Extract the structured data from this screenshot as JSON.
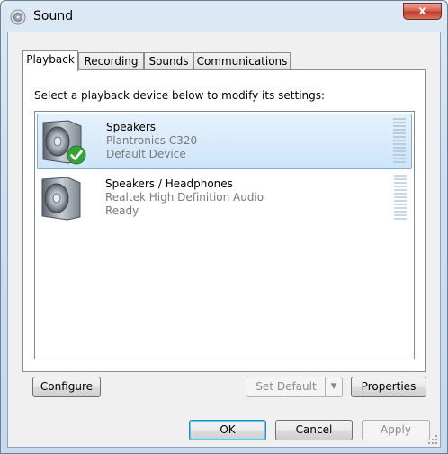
{
  "window": {
    "title": "Sound",
    "close_label": "x"
  },
  "tabs": [
    {
      "label": "Playback",
      "active": true
    },
    {
      "label": "Recording",
      "active": false
    },
    {
      "label": "Sounds",
      "active": false
    },
    {
      "label": "Communications",
      "active": false
    }
  ],
  "playback": {
    "instruction": "Select a playback device below to modify its settings:",
    "devices": [
      {
        "name": "Speakers",
        "description": "Plantronics C320",
        "status": "Default Device",
        "selected": true,
        "icon": "speaker-icon",
        "badge": "default-check-icon"
      },
      {
        "name": "Speakers / Headphones",
        "description": "Realtek High Definition Audio",
        "status": "Ready",
        "selected": false,
        "icon": "speaker-icon"
      }
    ],
    "configure_label": "Configure",
    "set_default_label": "Set Default",
    "properties_label": "Properties"
  },
  "footer": {
    "ok_label": "OK",
    "cancel_label": "Cancel",
    "apply_label": "Apply"
  },
  "colors": {
    "selection": "#cde4f9",
    "accent_check": "#3aa53a",
    "close_button": "#c13e2b"
  }
}
